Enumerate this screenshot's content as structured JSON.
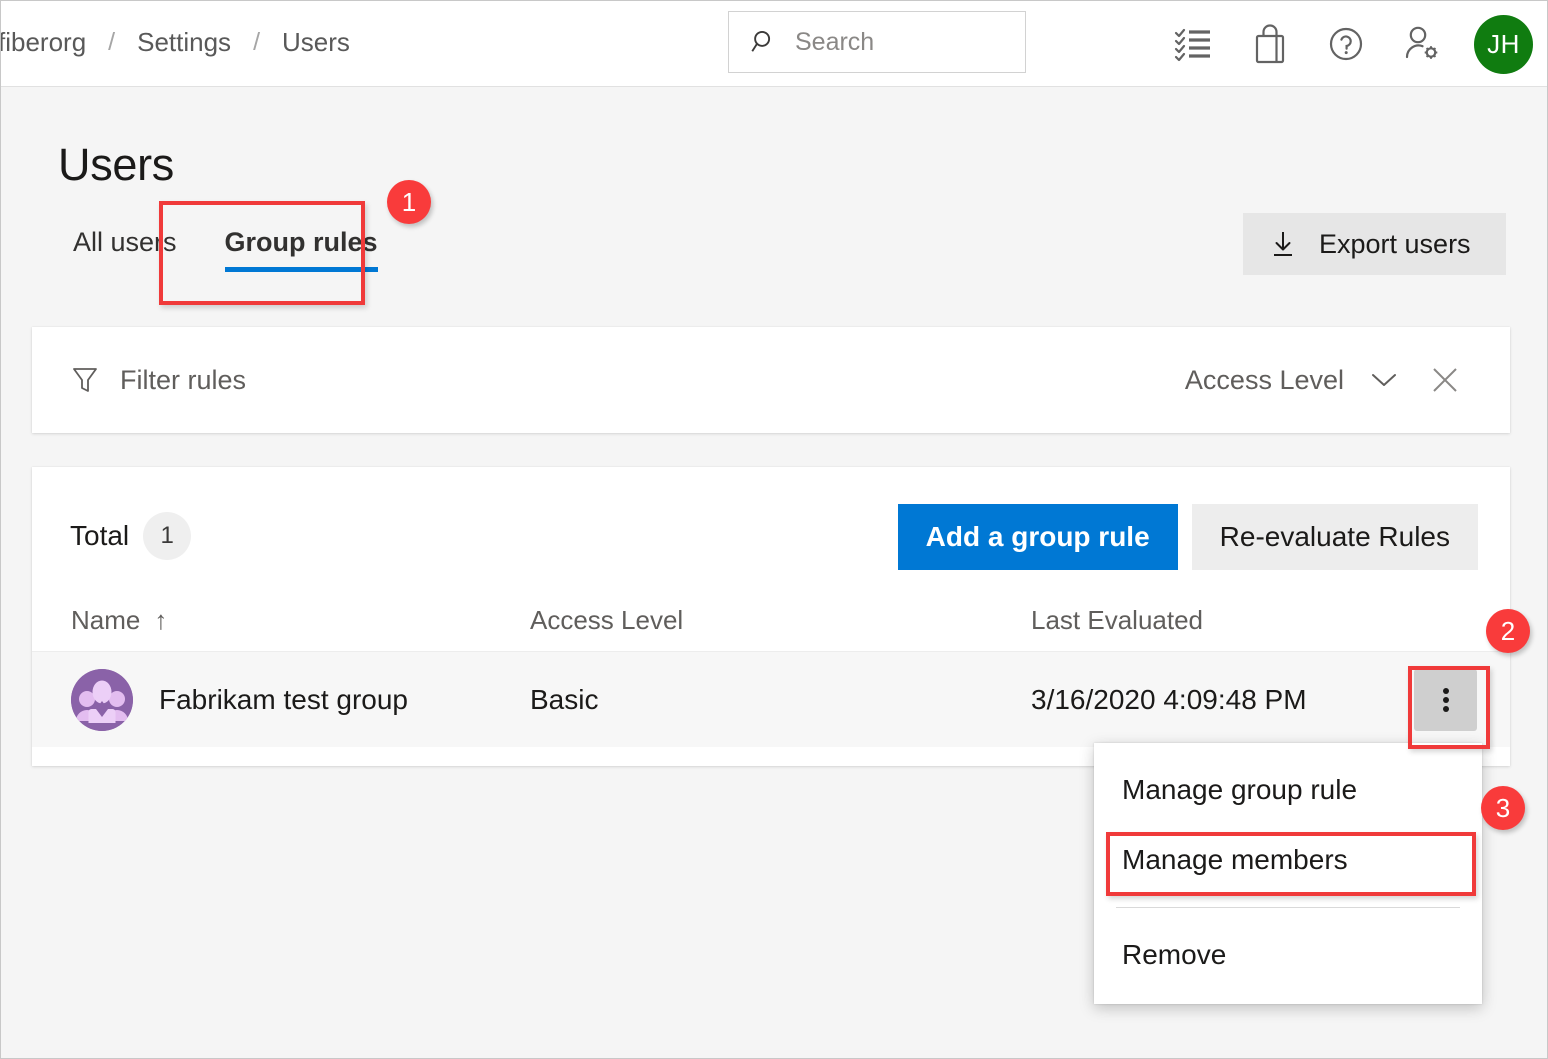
{
  "header": {
    "breadcrumb": [
      "fiberorg",
      "Settings",
      "Users"
    ],
    "breadcrumb_separator": "/",
    "search": {
      "placeholder": "Search",
      "value": "",
      "icon": "search-icon"
    },
    "icons": [
      {
        "name": "checklist-icon",
        "label": "Tasks"
      },
      {
        "name": "shopping-bag-icon",
        "label": "Marketplace"
      },
      {
        "name": "help-icon",
        "label": "Help"
      },
      {
        "name": "user-settings-icon",
        "label": "User settings"
      }
    ],
    "avatar": {
      "initials": "JH",
      "color": "#107c10"
    }
  },
  "page": {
    "title": "Users",
    "tabs": [
      {
        "label": "All users",
        "active": false
      },
      {
        "label": "Group rules",
        "active": true
      }
    ],
    "export_button": {
      "label": "Export users",
      "icon": "download-icon"
    }
  },
  "filter": {
    "icon": "funnel-icon",
    "label": "Filter rules",
    "dropdown": {
      "label": "Access Level",
      "icon": "chevron-down-icon"
    },
    "clear_icon": "close-icon"
  },
  "table": {
    "total_label": "Total",
    "total_count": "1",
    "add_button": "Add a group rule",
    "reevaluate_button": "Re-evaluate Rules",
    "columns": [
      {
        "label": "Name",
        "sort": "↑"
      },
      {
        "label": "Access Level",
        "sort": ""
      },
      {
        "label": "Last Evaluated",
        "sort": ""
      }
    ],
    "rows": [
      {
        "avatar_icon": "group-avatar-icon",
        "name": "Fabrikam test group",
        "access_level": "Basic",
        "last_evaluated": "3/16/2020 4:09:48 PM",
        "menu_icon": "more-vertical-icon"
      }
    ]
  },
  "context_menu": {
    "items": [
      {
        "label": "Manage group rule",
        "highlighted": false
      },
      {
        "label": "Manage members",
        "highlighted": true
      },
      {
        "label": "Remove",
        "highlighted": false
      }
    ]
  },
  "annotations": {
    "callouts": [
      {
        "number": "1"
      },
      {
        "number": "2"
      },
      {
        "number": "3"
      }
    ],
    "color": "#f93b3b"
  }
}
